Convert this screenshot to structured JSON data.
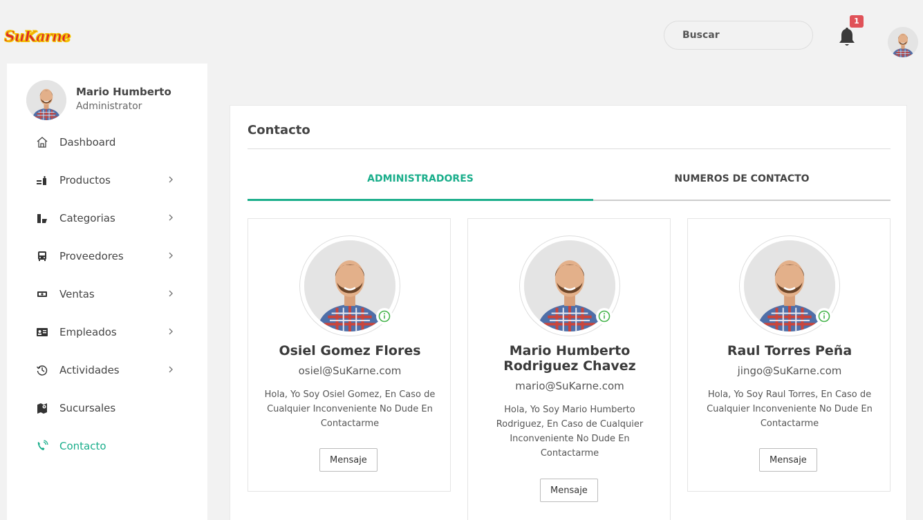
{
  "header": {
    "logo_text": "SuKarne",
    "search_placeholder": "Buscar",
    "notification_count": "1"
  },
  "sidebar": {
    "profile_name": "Mario Humberto",
    "profile_role": "Administrator",
    "items": [
      {
        "label": "Dashboard",
        "icon": "home-icon",
        "has_children": false
      },
      {
        "label": "Productos",
        "icon": "products-icon",
        "has_children": true
      },
      {
        "label": "Categorias",
        "icon": "categories-icon",
        "has_children": true
      },
      {
        "label": "Proveedores",
        "icon": "bus-icon",
        "has_children": true
      },
      {
        "label": "Ventas",
        "icon": "money-icon",
        "has_children": true
      },
      {
        "label": "Empleados",
        "icon": "id-card-icon",
        "has_children": true
      },
      {
        "label": "Actividades",
        "icon": "history-icon",
        "has_children": true
      },
      {
        "label": "Sucursales",
        "icon": "map-icon",
        "has_children": false
      },
      {
        "label": "Contacto",
        "icon": "phone-icon",
        "has_children": false,
        "active": true
      }
    ]
  },
  "main": {
    "title": "Contacto",
    "tabs": [
      {
        "label": "ADMINISTRADORES",
        "active": true
      },
      {
        "label": "NUMEROS DE CONTACTO",
        "active": false
      }
    ],
    "contacts": [
      {
        "name": "Osiel Gomez Flores",
        "email": "osiel@SuKarne.com",
        "description": "Hola, Yo Soy Osiel Gomez, En Caso de Cualquier Inconveniente No Dude En Contactarme",
        "button_label": "Mensaje"
      },
      {
        "name": "Mario Humberto Rodriguez Chavez",
        "email": "mario@SuKarne.com",
        "description": "Hola, Yo Soy Mario Humberto Rodriguez, En Caso de Cualquier Inconveniente No Dude En Contactarme",
        "button_label": "Mensaje"
      },
      {
        "name": "Raul Torres Peña",
        "email": "jingo@SuKarne.com",
        "description": "Hola, Yo Soy Raul Torres, En Caso de Cualquier Inconveniente No Dude En Contactarme",
        "button_label": "Mensaje"
      }
    ]
  },
  "colors": {
    "accent": "#1aae8b",
    "badge": "#e05258",
    "brand_red": "#d9262e",
    "brand_yellow": "#f5c400"
  }
}
